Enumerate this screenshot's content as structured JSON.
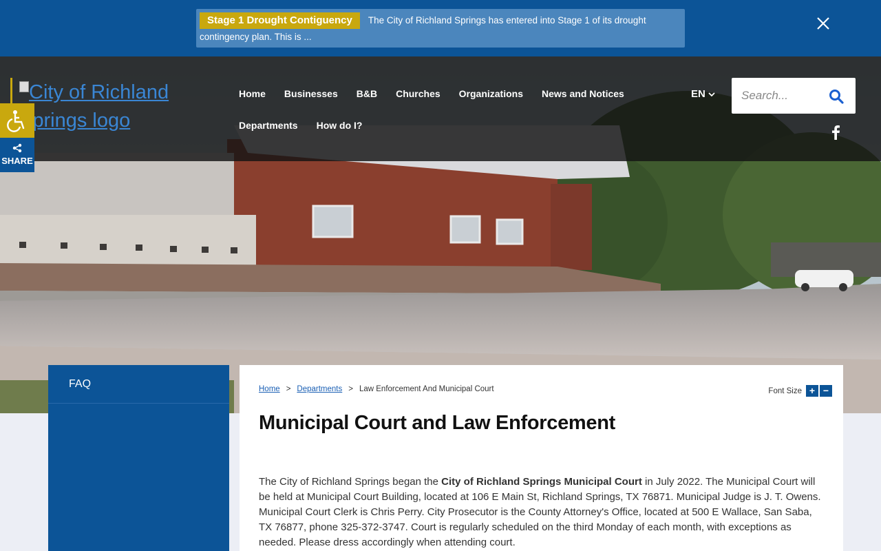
{
  "alert": {
    "badge": "Stage 1 Drought Contiguency",
    "text_line1": "The City of Richland Springs has entered into Stage 1 of its drought",
    "text_line2": "contingency plan. This is ..."
  },
  "header": {
    "logo_alt": "City of Richland Springs logo",
    "nav_row1": [
      "Home",
      "Businesses",
      "B&B",
      "Churches",
      "Organizations",
      "News and Notices"
    ],
    "nav_row2": [
      "Departments",
      "How do I?"
    ],
    "language": "EN",
    "search_placeholder": "Search..."
  },
  "share": {
    "label": "SHARE"
  },
  "sidebar": {
    "items": [
      {
        "label": "FAQ"
      }
    ]
  },
  "breadcrumb": {
    "home": "Home",
    "departments": "Departments",
    "current": "Law Enforcement And Municipal Court",
    "sep": ">"
  },
  "font_size": {
    "label": "Font Size",
    "increase": "+",
    "decrease": "−"
  },
  "page": {
    "title": "Municipal Court and Law Enforcement",
    "para_before": "The City of Richland Springs began the ",
    "para_bold": "City of Richland Springs Municipal Court",
    "para_after": " in July 2022. The Municipal Court will be held at Municipal Court Building, located at 106 E Main St, Richland Springs, TX 76871. Municipal Judge is J. T. Owens.  Municipal Court Clerk is Chris Perry.  City Prosecutor is the County Attorney's Office, located at 500 E Wallace, San Saba, TX 76877, phone 325-372-3747. Court is regularly scheduled on the third Monday of each month, with exceptions as needed. Please dress accordingly when attending court."
  },
  "colors": {
    "primary_blue": "#0c5497",
    "accent_gold": "#c9a80e",
    "alert_box": "#4b86bd"
  }
}
